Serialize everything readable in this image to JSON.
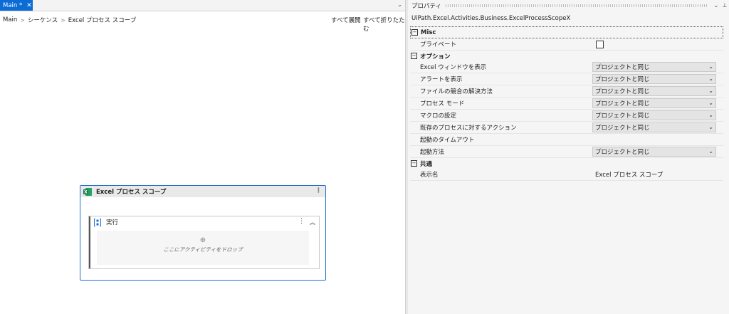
{
  "tab": {
    "label": "Main *",
    "close": "✕"
  },
  "breadcrumb": [
    "Main",
    "シーケンス",
    "Excel プロセス スコープ"
  ],
  "toolbar": {
    "expand_all": "すべて展開",
    "collapse_all": "すべて折りたたむ"
  },
  "activity": {
    "title": "Excel プロセス スコープ",
    "sequence_title": "実行",
    "drop_hint": "ここにアクティビティをドロップ"
  },
  "properties": {
    "title": "プロパティ",
    "type_name": "UiPath.Excel.Activities.Business.ExcelProcessScopeX",
    "categories": [
      {
        "name": "Misc",
        "rows": [
          {
            "name": "プライベート",
            "kind": "checkbox",
            "checked": false
          }
        ]
      },
      {
        "name": "オプション",
        "rows": [
          {
            "name": "Excel ウィンドウを表示",
            "kind": "select",
            "value": "プロジェクトと同じ"
          },
          {
            "name": "アラートを表示",
            "kind": "select",
            "value": "プロジェクトと同じ"
          },
          {
            "name": "ファイルの競合の解決方法",
            "kind": "select",
            "value": "プロジェクトと同じ"
          },
          {
            "name": "プロセス モード",
            "kind": "select",
            "value": "プロジェクトと同じ"
          },
          {
            "name": "マクロの設定",
            "kind": "select",
            "value": "プロジェクトと同じ"
          },
          {
            "name": "既存のプロセスに対するアクション",
            "kind": "select",
            "value": "プロジェクトと同じ"
          },
          {
            "name": "起動のタイムアウト",
            "kind": "text",
            "value": ""
          },
          {
            "name": "起動方法",
            "kind": "select",
            "value": "プロジェクトと同じ"
          }
        ]
      },
      {
        "name": "共通",
        "rows": [
          {
            "name": "表示名",
            "kind": "text",
            "value": "Excel プロセス スコープ"
          }
        ]
      }
    ]
  },
  "icons": {
    "collapse": "⊟",
    "chevron": "⌄",
    "more": "⋮",
    "collapse_up": "︽",
    "add": "⊕"
  },
  "colors": {
    "accent": "#0b6cd6",
    "selection_border": "#1d6fd1",
    "excel_green": "#1e7145"
  }
}
